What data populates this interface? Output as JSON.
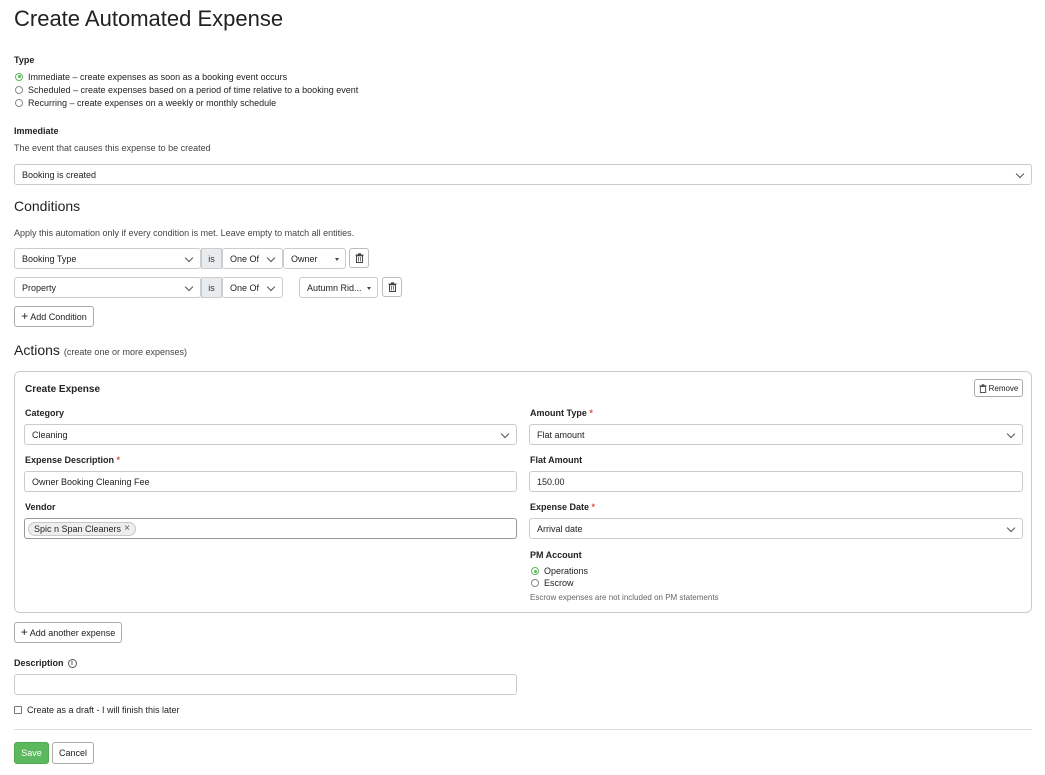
{
  "page": {
    "title": "Create Automated Expense"
  },
  "type": {
    "label": "Type",
    "options": [
      {
        "label": "Immediate – create expenses as soon as a booking event occurs",
        "selected": true
      },
      {
        "label": "Scheduled – create expenses based on a period of time relative to a booking event",
        "selected": false
      },
      {
        "label": "Recurring – create expenses on a weekly or monthly schedule",
        "selected": false
      }
    ]
  },
  "immediate": {
    "label": "Immediate",
    "help": "The event that causes this expense to be created",
    "event_value": "Booking is created"
  },
  "conditions": {
    "title": "Conditions",
    "help": "Apply this automation only if every condition is met. Leave empty to match all entities.",
    "rows": [
      {
        "field": "Booking Type",
        "op": "is",
        "match": "One Of",
        "value": "Owner"
      },
      {
        "field": "Property",
        "op": "is",
        "match": "One Of",
        "value": "Autumn Rid..."
      }
    ],
    "add_label": "Add Condition"
  },
  "actions": {
    "title": "Actions",
    "subtitle": "(create one or more expenses)",
    "card": {
      "title": "Create Expense",
      "remove_label": "Remove",
      "category": {
        "label": "Category",
        "value": "Cleaning"
      },
      "description": {
        "label": "Expense Description",
        "value": "Owner Booking Cleaning Fee"
      },
      "vendor": {
        "label": "Vendor",
        "tags": [
          "Spic n Span Cleaners"
        ]
      },
      "amount_type": {
        "label": "Amount Type",
        "value": "Flat amount"
      },
      "flat_amount": {
        "label": "Flat Amount",
        "value": "150.00"
      },
      "expense_date": {
        "label": "Expense Date",
        "value": "Arrival date"
      },
      "pm_account": {
        "label": "PM Account",
        "options": [
          {
            "label": "Operations",
            "selected": true
          },
          {
            "label": "Escrow",
            "selected": false
          }
        ],
        "help": "Escrow expenses are not included on PM statements"
      }
    },
    "add_label": "Add another expense"
  },
  "description": {
    "label": "Description",
    "value": ""
  },
  "draft": {
    "label": "Create as a draft - I will finish this later",
    "checked": false
  },
  "footer": {
    "save": "Save",
    "cancel": "Cancel"
  },
  "colors": {
    "accent": "#5cb85c",
    "required": "#d9534f"
  }
}
